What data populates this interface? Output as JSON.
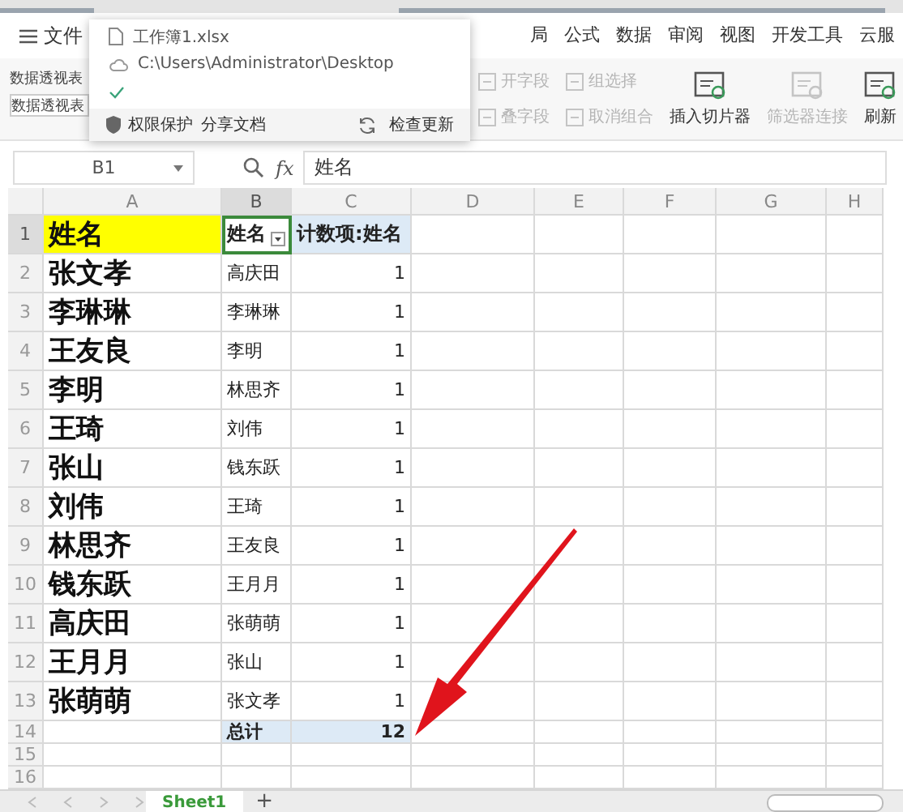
{
  "menu": {
    "label": "文件"
  },
  "ribbon_tabs": [
    {
      "label": "局",
      "selected": false
    },
    {
      "label": "公式",
      "selected": false
    },
    {
      "label": "数据",
      "selected": false
    },
    {
      "label": "审阅",
      "selected": false
    },
    {
      "label": "视图",
      "selected": false
    },
    {
      "label": "开发工具",
      "selected": false
    },
    {
      "label": "云服",
      "selected": false
    }
  ],
  "toolbar": {
    "name_label": "数据透视表",
    "name_value": "数据透视表",
    "buttons": [
      {
        "label": "开字段",
        "kind": "small",
        "disabled": true
      },
      {
        "label": "叠字段",
        "kind": "small",
        "disabled": true
      },
      {
        "label": "组选择",
        "kind": "small",
        "disabled": true
      },
      {
        "label": "取消组合",
        "kind": "small",
        "disabled": true
      },
      {
        "label": "插入切片器",
        "kind": "large",
        "disabled": false
      },
      {
        "label": "筛选器连接",
        "kind": "large",
        "disabled": true
      },
      {
        "label": "刷新",
        "kind": "large",
        "disabled": false
      }
    ]
  },
  "popup": {
    "file_name": "工作簿1.xlsx",
    "path": "C:\\Users\\Administrator\\Desktop",
    "saved": true,
    "actions": [
      {
        "label": "权限保护",
        "kind": "shield"
      },
      {
        "label": "分享文档",
        "kind": "plain"
      },
      {
        "label": "检查更新",
        "kind": "refresh"
      }
    ]
  },
  "formula_bar": {
    "cell_ref": "B1",
    "function_label": "fx",
    "formula": "姓名"
  },
  "sheet": {
    "columns": [
      {
        "label": "A",
        "selected": false
      },
      {
        "label": "B",
        "selected": true
      },
      {
        "label": "C",
        "selected": false
      },
      {
        "label": "D",
        "selected": false
      },
      {
        "label": "E",
        "selected": false
      },
      {
        "label": "F",
        "selected": false
      },
      {
        "label": "G",
        "selected": false
      },
      {
        "label": "H",
        "selected": false
      }
    ],
    "rows": [
      {
        "number": "1",
        "selected": true,
        "kind": "header",
        "name": "姓名",
        "pivot_label": "姓名",
        "pivot_value": "计数项:姓名"
      },
      {
        "number": "2",
        "selected": false,
        "kind": "data",
        "name": "张文孝",
        "pivot_label": "高庆田",
        "pivot_value": "1"
      },
      {
        "number": "3",
        "selected": false,
        "kind": "data",
        "name": "李琳琳",
        "pivot_label": "李琳琳",
        "pivot_value": "1"
      },
      {
        "number": "4",
        "selected": false,
        "kind": "data",
        "name": "王友良",
        "pivot_label": "李明",
        "pivot_value": "1"
      },
      {
        "number": "5",
        "selected": false,
        "kind": "data",
        "name": "李明",
        "pivot_label": "林思齐",
        "pivot_value": "1"
      },
      {
        "number": "6",
        "selected": false,
        "kind": "data",
        "name": "王琦",
        "pivot_label": "刘伟",
        "pivot_value": "1"
      },
      {
        "number": "7",
        "selected": false,
        "kind": "data",
        "name": "张山",
        "pivot_label": "钱东跃",
        "pivot_value": "1"
      },
      {
        "number": "8",
        "selected": false,
        "kind": "data",
        "name": "刘伟",
        "pivot_label": "王琦",
        "pivot_value": "1"
      },
      {
        "number": "9",
        "selected": false,
        "kind": "data",
        "name": "林思齐",
        "pivot_label": "王友良",
        "pivot_value": "1"
      },
      {
        "number": "10",
        "selected": false,
        "kind": "data",
        "name": "钱东跃",
        "pivot_label": "王月月",
        "pivot_value": "1"
      },
      {
        "number": "11",
        "selected": false,
        "kind": "data",
        "name": "高庆田",
        "pivot_label": "张萌萌",
        "pivot_value": "1"
      },
      {
        "number": "12",
        "selected": false,
        "kind": "data",
        "name": "王月月",
        "pivot_label": "张山",
        "pivot_value": "1"
      },
      {
        "number": "13",
        "selected": false,
        "kind": "data",
        "name": "张萌萌",
        "pivot_label": "张文孝",
        "pivot_value": "1"
      },
      {
        "number": "14",
        "selected": false,
        "kind": "total",
        "pivot_label": "总计",
        "pivot_value": "12"
      },
      {
        "number": "15",
        "selected": false,
        "kind": "empty"
      },
      {
        "number": "16",
        "selected": false,
        "kind": "empty"
      }
    ]
  },
  "sheet_tabs": {
    "tabs": [
      {
        "label": "Sheet1",
        "selected": true
      }
    ],
    "add_label": "+"
  }
}
